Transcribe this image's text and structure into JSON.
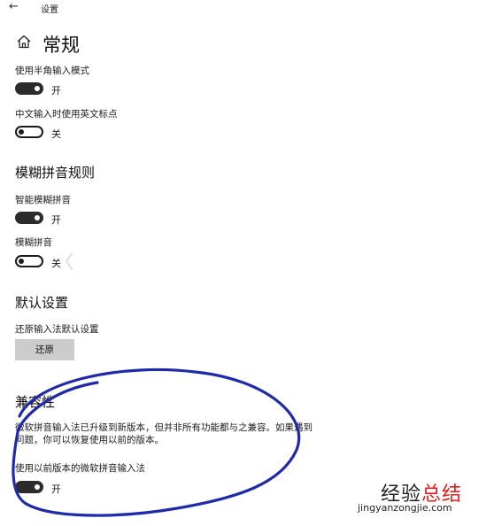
{
  "window": {
    "back_symbol": "←",
    "title": "设置"
  },
  "page_title": "常规",
  "sections": {
    "general": {
      "halfwidth_label": "使用半角输入模式",
      "halfwidth_state": "开",
      "halfwidth_on": true,
      "en_punct_label": "中文输入时使用英文标点",
      "en_punct_state": "关",
      "en_punct_on": false
    },
    "fuzzy": {
      "heading": "模糊拼音规则",
      "smart_label": "智能模糊拼音",
      "smart_state": "开",
      "smart_on": true,
      "fuzzy_label": "模糊拼音",
      "fuzzy_state": "关",
      "fuzzy_on": false
    },
    "defaults": {
      "heading": "默认设置",
      "restore_label": "还原输入法默认设置",
      "restore_button": "还原"
    },
    "compat": {
      "heading": "兼容性",
      "description": "微软拼音输入法已升级到新版本，但并非所有功能都与之兼容。如果遇到问题，你可以恢复使用以前的版本。",
      "prev_label": "使用以前版本的微软拼音输入法",
      "prev_state": "开",
      "prev_on": true
    }
  },
  "annotation": {
    "color": "#1f2aa8"
  },
  "watermark": {
    "brand_dark": "经验",
    "brand_red": "总结",
    "url": "jingyanzongjie.com"
  }
}
